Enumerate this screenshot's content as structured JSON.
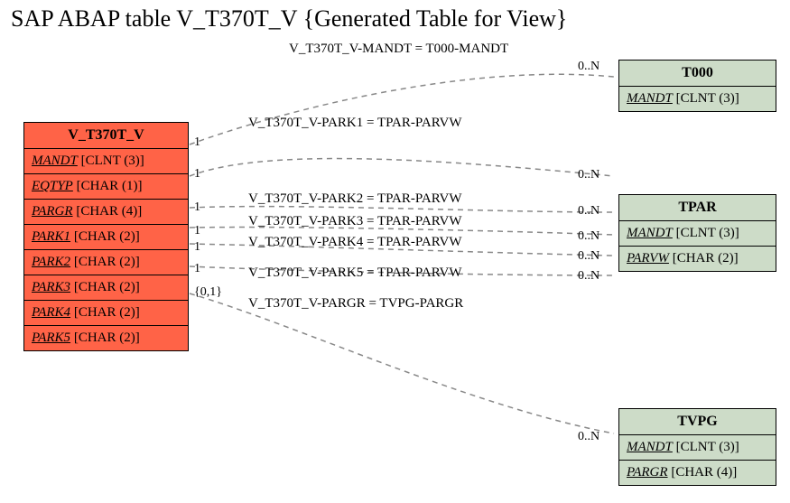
{
  "title": "SAP ABAP table V_T370T_V {Generated Table for View}",
  "main": {
    "name": "V_T370T_V",
    "fields": [
      {
        "name": "MANDT",
        "type": "CLNT (3)"
      },
      {
        "name": "EQTYP",
        "type": "CHAR (1)"
      },
      {
        "name": "PARGR",
        "type": "CHAR (4)"
      },
      {
        "name": "PARK1",
        "type": "CHAR (2)"
      },
      {
        "name": "PARK2",
        "type": "CHAR (2)"
      },
      {
        "name": "PARK3",
        "type": "CHAR (2)"
      },
      {
        "name": "PARK4",
        "type": "CHAR (2)"
      },
      {
        "name": "PARK5",
        "type": "CHAR (2)"
      }
    ]
  },
  "t000": {
    "name": "T000",
    "fields": [
      {
        "name": "MANDT",
        "type": "CLNT (3)"
      }
    ]
  },
  "tpar": {
    "name": "TPAR",
    "fields": [
      {
        "name": "MANDT",
        "type": "CLNT (3)"
      },
      {
        "name": "PARVW",
        "type": "CHAR (2)"
      }
    ]
  },
  "tvpg": {
    "name": "TVPG",
    "fields": [
      {
        "name": "MANDT",
        "type": "CLNT (3)"
      },
      {
        "name": "PARGR",
        "type": "CHAR (4)"
      }
    ]
  },
  "rel": {
    "r0": "V_T370T_V-MANDT = T000-MANDT",
    "r1": "V_T370T_V-PARK1 = TPAR-PARVW",
    "r2": "V_T370T_V-PARK2 = TPAR-PARVW",
    "r3": "V_T370T_V-PARK3 = TPAR-PARVW",
    "r4": "V_T370T_V-PARK4 = TPAR-PARVW",
    "r5": "V_T370T_V-PARK5 = TPAR-PARVW",
    "r6": "V_T370T_V-PARGR = TVPG-PARGR"
  },
  "card": {
    "one": "1",
    "zeroOne": "{0,1}",
    "zeroN": "0..N"
  },
  "chart_data": {
    "type": "table",
    "title": "SAP ABAP table V_T370T_V {Generated Table for View}",
    "entities": [
      {
        "name": "V_T370T_V",
        "color": "#ff6347",
        "fields": [
          {
            "name": "MANDT",
            "type": "CLNT (3)"
          },
          {
            "name": "EQTYP",
            "type": "CHAR (1)"
          },
          {
            "name": "PARGR",
            "type": "CHAR (4)"
          },
          {
            "name": "PARK1",
            "type": "CHAR (2)"
          },
          {
            "name": "PARK2",
            "type": "CHAR (2)"
          },
          {
            "name": "PARK3",
            "type": "CHAR (2)"
          },
          {
            "name": "PARK4",
            "type": "CHAR (2)"
          },
          {
            "name": "PARK5",
            "type": "CHAR (2)"
          }
        ]
      },
      {
        "name": "T000",
        "color": "#cddcc8",
        "fields": [
          {
            "name": "MANDT",
            "type": "CLNT (3)"
          }
        ]
      },
      {
        "name": "TPAR",
        "color": "#cddcc8",
        "fields": [
          {
            "name": "MANDT",
            "type": "CLNT (3)"
          },
          {
            "name": "PARVW",
            "type": "CHAR (2)"
          }
        ]
      },
      {
        "name": "TVPG",
        "color": "#cddcc8",
        "fields": [
          {
            "name": "MANDT",
            "type": "CLNT (3)"
          },
          {
            "name": "PARGR",
            "type": "CHAR (4)"
          }
        ]
      }
    ],
    "relationships": [
      {
        "from": "V_T370T_V.MANDT",
        "to": "T000.MANDT",
        "label": "V_T370T_V-MANDT = T000-MANDT",
        "card_from": "1",
        "card_to": "0..N"
      },
      {
        "from": "V_T370T_V.PARK1",
        "to": "TPAR.PARVW",
        "label": "V_T370T_V-PARK1 = TPAR-PARVW",
        "card_from": "1",
        "card_to": "0..N"
      },
      {
        "from": "V_T370T_V.PARK2",
        "to": "TPAR.PARVW",
        "label": "V_T370T_V-PARK2 = TPAR-PARVW",
        "card_from": "1",
        "card_to": "0..N"
      },
      {
        "from": "V_T370T_V.PARK3",
        "to": "TPAR.PARVW",
        "label": "V_T370T_V-PARK3 = TPAR-PARVW",
        "card_from": "1",
        "card_to": "0..N"
      },
      {
        "from": "V_T370T_V.PARK4",
        "to": "TPAR.PARVW",
        "label": "V_T370T_V-PARK4 = TPAR-PARVW",
        "card_from": "1",
        "card_to": "0..N"
      },
      {
        "from": "V_T370T_V.PARK5",
        "to": "TPAR.PARVW",
        "label": "V_T370T_V-PARK5 = TPAR-PARVW",
        "card_from": "1",
        "card_to": "0..N"
      },
      {
        "from": "V_T370T_V.PARGR",
        "to": "TVPG.PARGR",
        "label": "V_T370T_V-PARGR = TVPG-PARGR",
        "card_from": "{0,1}",
        "card_to": "0..N"
      }
    ]
  }
}
